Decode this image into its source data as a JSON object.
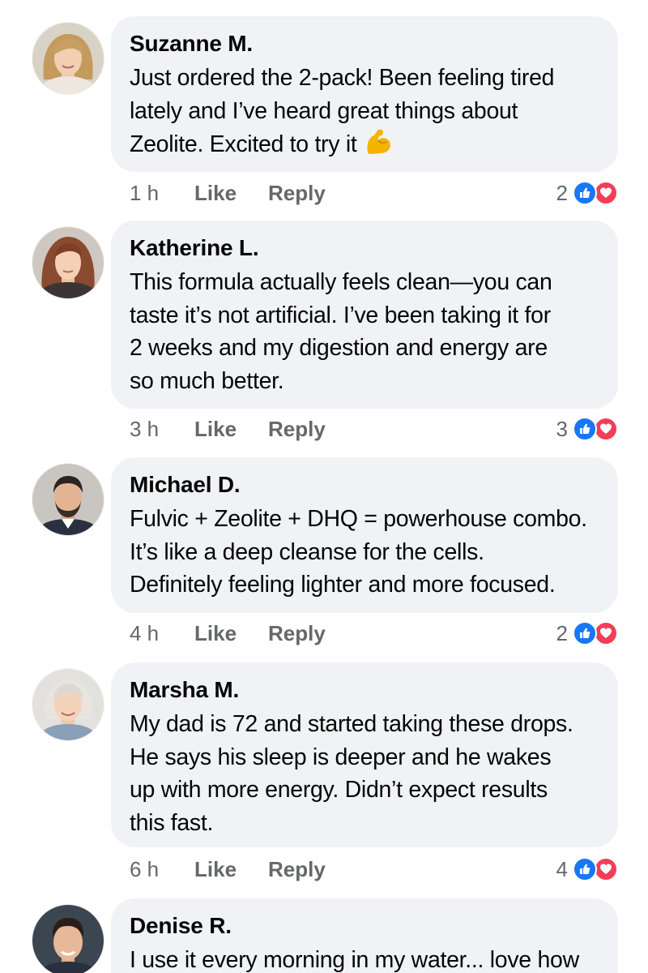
{
  "comments": [
    {
      "author": "Suzanne M.",
      "lines": [
        "Just ordered the 2-pack! Been feeling tired",
        "lately and I’ve heard great things about",
        "Zeolite. Excited to try it"
      ],
      "emoji": "flexed-biceps",
      "time": "1 h",
      "like_label": "Like",
      "reply_label": "Reply",
      "reaction_count": "2"
    },
    {
      "author": "Katherine L.",
      "lines": [
        "This formula actually feels clean—you can",
        "taste it’s not artificial. I’ve been taking it for",
        "2 weeks and my digestion and energy are",
        "so much better."
      ],
      "time": "3 h",
      "like_label": "Like",
      "reply_label": "Reply",
      "reaction_count": "3"
    },
    {
      "author": "Michael D.",
      "lines": [
        "Fulvic + Zeolite + DHQ = powerhouse combo.",
        "It’s like a deep cleanse for the cells.",
        "Definitely feeling lighter and more focused."
      ],
      "time": "4 h",
      "like_label": "Like",
      "reply_label": "Reply",
      "reaction_count": "2"
    },
    {
      "author": "Marsha M.",
      "lines": [
        "My dad is 72 and started taking these drops.",
        "He says his sleep is deeper and he wakes",
        "up with more energy. Didn’t expect results",
        "this fast."
      ],
      "time": "6 h",
      "like_label": "Like",
      "reply_label": "Reply",
      "reaction_count": "4"
    },
    {
      "author": "Denise R.",
      "lines": [
        "I use it every morning in my water... love how"
      ]
    }
  ],
  "colors": {
    "bubble": "#f0f2f5",
    "meta_text": "#65676b",
    "like_blue": "#1877f2",
    "love_red": "#f33e58"
  },
  "icons": [
    "like-reaction-icon",
    "love-reaction-icon",
    "flexed-biceps-emoji"
  ]
}
